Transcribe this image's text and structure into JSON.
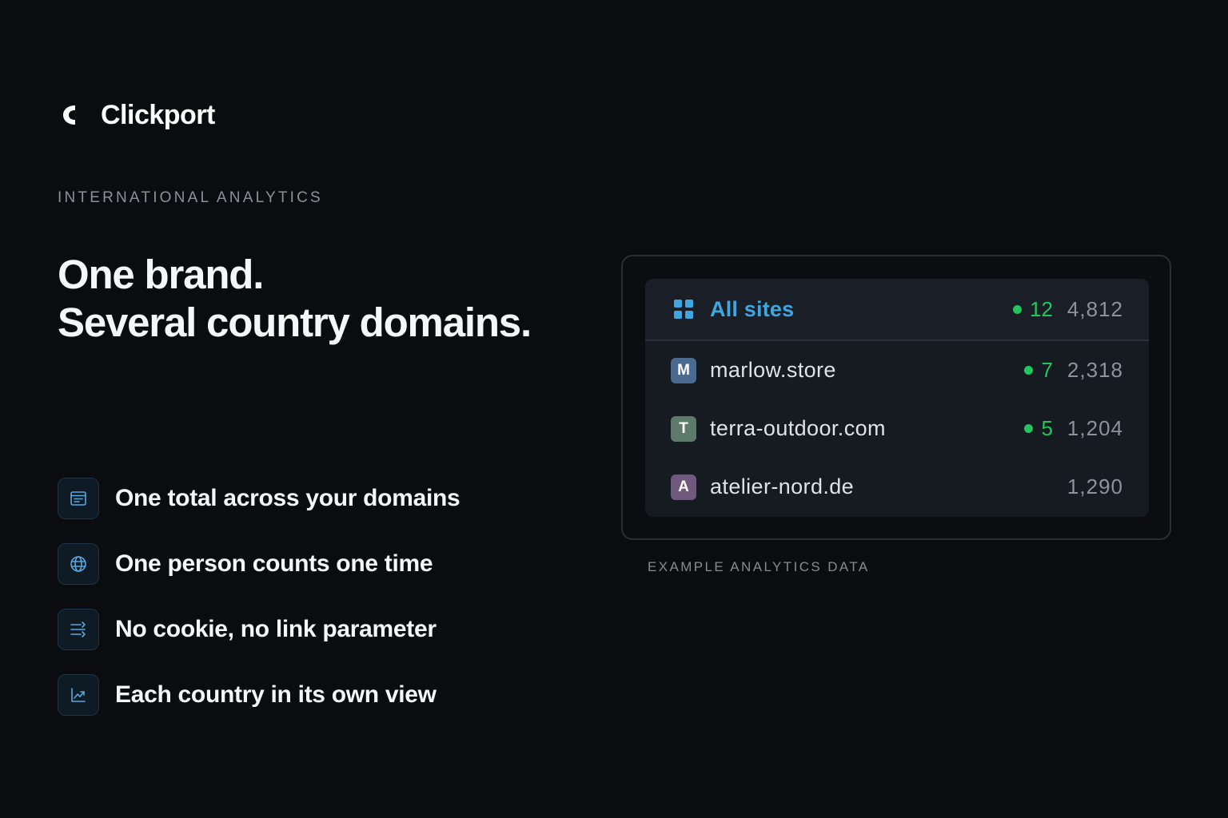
{
  "brand": {
    "name": "Clickport",
    "icon": "logo-c-icon"
  },
  "eyebrow": "INTERNATIONAL ANALYTICS",
  "headline": {
    "line1": "One brand.",
    "line2": "Several country domains."
  },
  "features": [
    {
      "icon": "layout-list-icon",
      "label": "One total across your domains"
    },
    {
      "icon": "globe-icon",
      "label": "One person counts one time"
    },
    {
      "icon": "arrows-transfer-icon",
      "label": "No cookie, no link parameter"
    },
    {
      "icon": "trend-chart-icon",
      "label": "Each country in its own view"
    }
  ],
  "card": {
    "header": {
      "icon": "grid-icon",
      "label": "All sites",
      "live": "12",
      "total": "4,812"
    },
    "sites": [
      {
        "letter": "M",
        "name": "marlow.store",
        "live": "7",
        "total": "2,318",
        "color": "#4a6b8f"
      },
      {
        "letter": "T",
        "name": "terra-outdoor.com",
        "live": "5",
        "total": "1,204",
        "color": "#5e7a6a"
      },
      {
        "letter": "A",
        "name": "atelier-nord.de",
        "live": "",
        "total": "1,290",
        "color": "#6f5a7e"
      }
    ]
  },
  "caption": "EXAMPLE ANALYTICS DATA",
  "colors": {
    "accent": "#3fa6e0",
    "live": "#22c55e",
    "background": "#0b0c0f"
  }
}
